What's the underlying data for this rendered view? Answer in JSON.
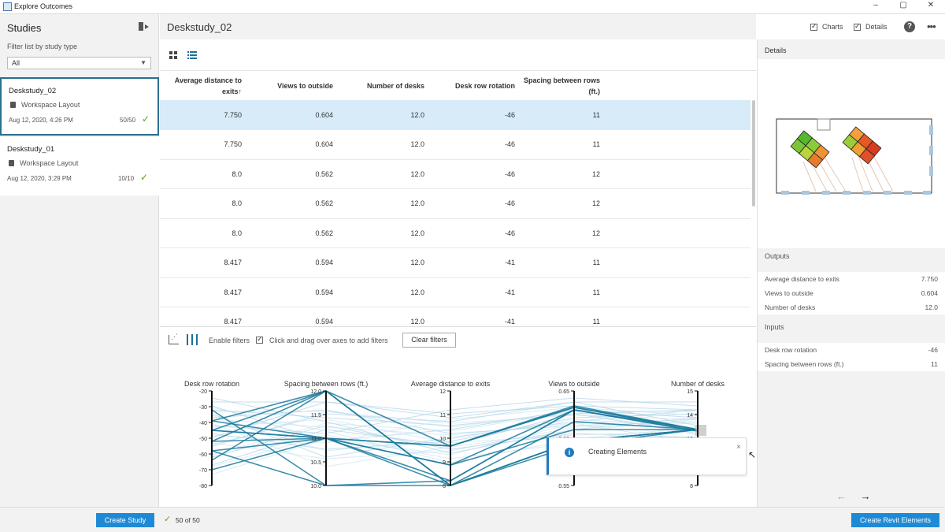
{
  "window": {
    "title": "Explore Outcomes",
    "minimize": "–",
    "maximize": "▢",
    "close": "✕"
  },
  "sidebar": {
    "title": "Studies",
    "filter_label": "Filter list by study type",
    "filter_value": "All",
    "studies": [
      {
        "name": "Deskstudy_02",
        "type": "Workspace Layout",
        "date": "Aug 12, 2020, 4:26 PM",
        "count": "50/50",
        "check": "✓"
      },
      {
        "name": "Deskstudy_01",
        "type": "Workspace Layout",
        "date": "Aug 12, 2020, 3:29 PM",
        "count": "10/10",
        "check": "✓"
      }
    ]
  },
  "main": {
    "title": "Deskstudy_02",
    "topbar": {
      "charts_label": "Charts",
      "details_label": "Details",
      "help": "?",
      "more": "•••"
    },
    "table": {
      "headers": [
        "Average distance to exits",
        "Views to outside",
        "Number of desks",
        "Desk row rotation",
        "Spacing between rows (ft.)"
      ],
      "sort_indicator": "↑",
      "rows": [
        [
          "7.750",
          "0.604",
          "12.0",
          "-46",
          "11"
        ],
        [
          "7.750",
          "0.604",
          "12.0",
          "-46",
          "11"
        ],
        [
          "8.0",
          "0.562",
          "12.0",
          "-46",
          "12"
        ],
        [
          "8.0",
          "0.562",
          "12.0",
          "-46",
          "12"
        ],
        [
          "8.0",
          "0.562",
          "12.0",
          "-46",
          "12"
        ],
        [
          "8.417",
          "0.594",
          "12.0",
          "-41",
          "11"
        ],
        [
          "8.417",
          "0.594",
          "12.0",
          "-41",
          "11"
        ],
        [
          "8.417",
          "0.594",
          "12.0",
          "-41",
          "11"
        ]
      ]
    },
    "filters": {
      "enable_label": "Enable filters",
      "hint": "Click and drag over axes to add filters",
      "clear_label": "Clear filters"
    },
    "parallel_coords": {
      "axes": [
        {
          "label": "Desk row rotation",
          "ticks": [
            "-20",
            "-30",
            "-40",
            "-50",
            "-60",
            "-70",
            "-80"
          ]
        },
        {
          "label": "Spacing between rows (ft.)",
          "ticks": [
            "12.0",
            "11.5",
            "11.0",
            "10.5",
            "10.0"
          ]
        },
        {
          "label": "Average distance to exits",
          "ticks": [
            "12",
            "11",
            "10",
            "9",
            "8"
          ]
        },
        {
          "label": "Views to outside",
          "ticks": [
            "0.65",
            "0.60",
            "0.55"
          ]
        },
        {
          "label": "Number of desks",
          "ticks": [
            "15",
            "14",
            "13",
            "12",
            "8"
          ]
        }
      ]
    },
    "toast": {
      "message": "Creating Elements",
      "icon": "i",
      "close": "×"
    }
  },
  "details": {
    "title": "Details",
    "outputs_label": "Outputs",
    "outputs": [
      {
        "key": "Average distance to exits",
        "value": "7.750"
      },
      {
        "key": "Views to outside",
        "value": "0.604"
      },
      {
        "key": "Number of desks",
        "value": "12.0"
      }
    ],
    "inputs_label": "Inputs",
    "inputs": [
      {
        "key": "Desk row rotation",
        "value": "-46"
      },
      {
        "key": "Spacing between rows (ft.)",
        "value": "11"
      }
    ],
    "prev": "←",
    "next": "→"
  },
  "bottom": {
    "create_study": "Create Study",
    "status_check": "✓",
    "status": "50 of 50",
    "create_revit": "Create Revit Elements"
  }
}
